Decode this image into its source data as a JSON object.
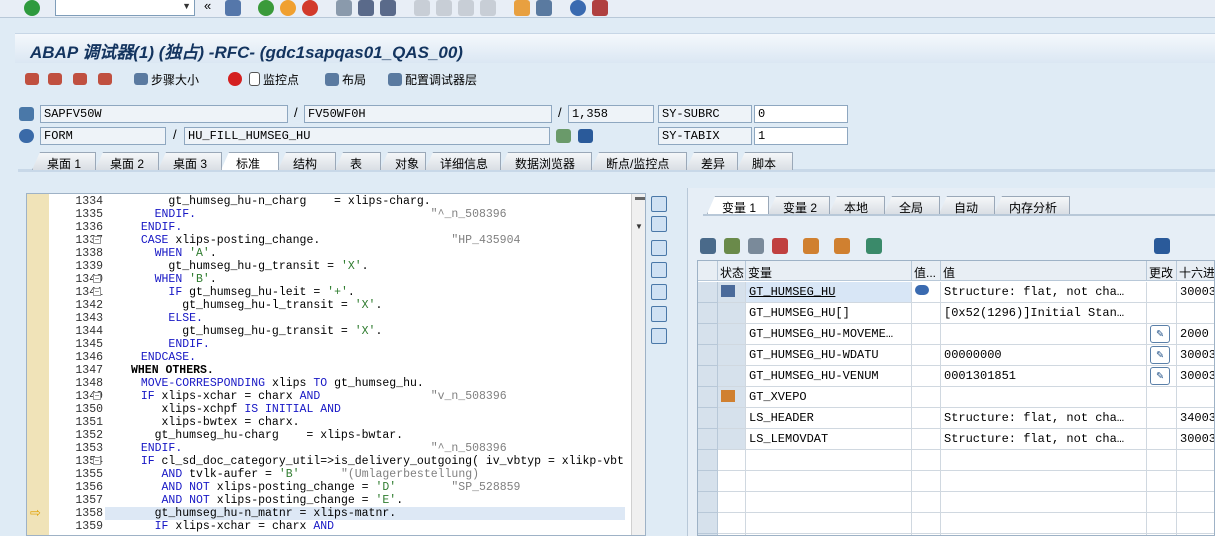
{
  "toolbar": {
    "command_value": ""
  },
  "title": "ABAP 调试器(1)  (独占) -RFC- (gdc1sapqas01_QAS_00)",
  "app_toolbar": {
    "step_size": "步骤大小",
    "watchpoint": "监控点",
    "layout": "布局",
    "config_layers": "配置调试器层"
  },
  "fields": {
    "program": "SAPFV50W",
    "include": "FV50WF0H",
    "line": "1,358",
    "sy_subrc_label": "SY-SUBRC",
    "sy_subrc_value": "0",
    "type": "FORM",
    "routine": "HU_FILL_HUMSEG_HU",
    "sy_tabix_label": "SY-TABIX",
    "sy_tabix_value": "1"
  },
  "tabs": [
    "桌面 1",
    "桌面 2",
    "桌面 3",
    "标准",
    "结构",
    "表",
    "对象",
    "详细信息",
    "数据浏览器",
    "断点/监控点",
    "差异",
    "脚本"
  ],
  "right_tabs": [
    "变量 1",
    "变量 2",
    "本地",
    "全局",
    "自动",
    "内存分析"
  ],
  "grid": {
    "headers": [
      "状态",
      "变量",
      "值...",
      "值",
      "更改",
      "十六进制"
    ],
    "rows": [
      {
        "var": "GT_HUMSEG_HU",
        "value": "Structure: flat, not cha…",
        "hex": "30003"
      },
      {
        "var": "GT_HUMSEG_HU[]",
        "value": "[0x52(1296)]Initial Stan…",
        "hex": ""
      },
      {
        "var": "GT_HUMSEG_HU-MOVEME…",
        "value": "",
        "hex": "2000"
      },
      {
        "var": "GT_HUMSEG_HU-WDATU",
        "value": "00000000",
        "hex": "30003"
      },
      {
        "var": "GT_HUMSEG_HU-VENUM",
        "value": "0001301851",
        "hex": "30003"
      },
      {
        "var": "GT_XVEPO",
        "value": "",
        "hex": ""
      },
      {
        "var": "LS_HEADER",
        "value": "Structure: flat, not cha…",
        "hex": "34003"
      },
      {
        "var": "LS_LEMOVDAT",
        "value": "Structure: flat, not cha…",
        "hex": "30003"
      }
    ]
  },
  "code": {
    "line_numbers": [
      "1334",
      "1335",
      "1336",
      "1337",
      "1338",
      "1339",
      "1340",
      "1341",
      "1342",
      "1343",
      "1344",
      "1345",
      "1346",
      "1347",
      "1348",
      "1349",
      "1350",
      "1351",
      "1352",
      "1353",
      "1354",
      "1355",
      "1356",
      "1357",
      "1358",
      "1359"
    ],
    "current_line": "1358"
  }
}
